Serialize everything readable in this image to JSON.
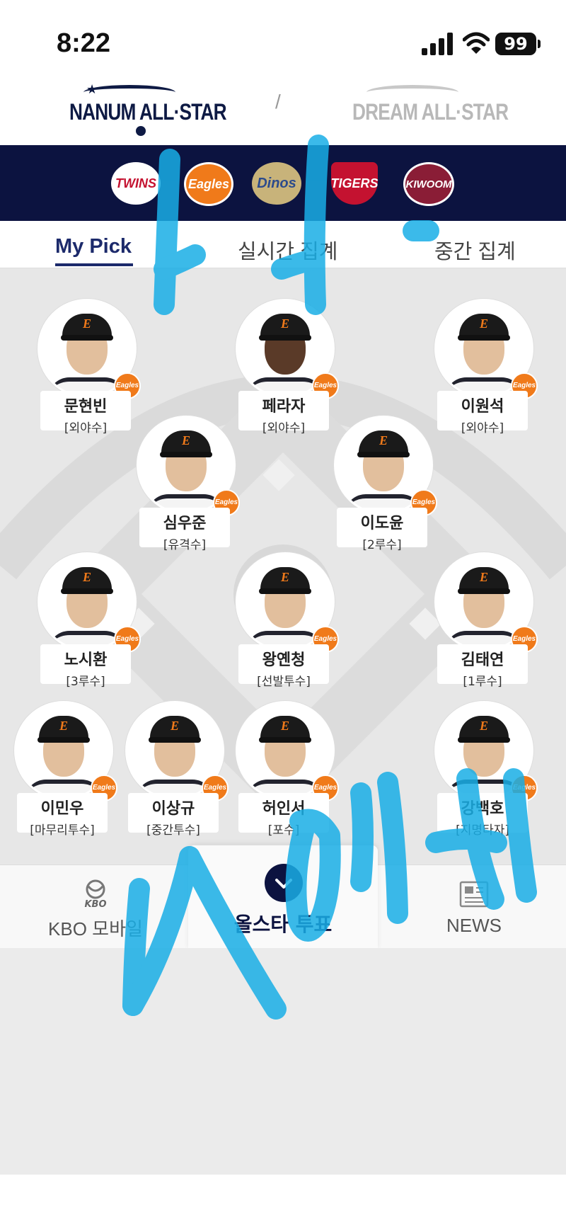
{
  "status_bar": {
    "time": "8:22",
    "battery": "99"
  },
  "league_switch": {
    "nanum": "NANUM ALL·STAR",
    "separator": "/",
    "dream": "DREAM ALL·STAR"
  },
  "teams": [
    {
      "name": "TWINS",
      "color": "#c41230",
      "bg": "#ffffff"
    },
    {
      "name": "Eagles",
      "color": "#ffffff",
      "bg": "#f07a1a"
    },
    {
      "name": "Dinos",
      "color": "#2c4b8c",
      "bg": "#c8b37a"
    },
    {
      "name": "TIGERS",
      "color": "#ffffff",
      "bg": "#c41230"
    },
    {
      "name": "KIWOOM",
      "color": "#ffffff",
      "bg": "#8a1d36"
    }
  ],
  "tabs": [
    "My Pick",
    "실시간 집계",
    "중간 집계"
  ],
  "team_badge": "Eagles",
  "players": [
    {
      "name": "문현빈",
      "position": "[외야수]"
    },
    {
      "name": "페라자",
      "position": "[외야수]"
    },
    {
      "name": "이원석",
      "position": "[외야수]"
    },
    {
      "name": "심우준",
      "position": "[유격수]"
    },
    {
      "name": "이도윤",
      "position": "[2루수]"
    },
    {
      "name": "노시환",
      "position": "[3루수]"
    },
    {
      "name": "왕옌청",
      "position": "[선발투수]"
    },
    {
      "name": "김태연",
      "position": "[1루수]"
    },
    {
      "name": "이민우",
      "position": "[마무리투수]"
    },
    {
      "name": "이상규",
      "position": "[중간투수]"
    },
    {
      "name": "허인서",
      "position": "[포수]"
    },
    {
      "name": "강백호",
      "position": "[지명타자]"
    }
  ],
  "bottom_nav": {
    "kbo_label": "KBO 모바일",
    "kbo_icon_text": "KBO",
    "vote_label": "올스타 투표",
    "news_label": "NEWS"
  },
  "colors": {
    "navy": "#0c1340",
    "orange": "#f07a1a",
    "scribble": "#19aee6"
  }
}
